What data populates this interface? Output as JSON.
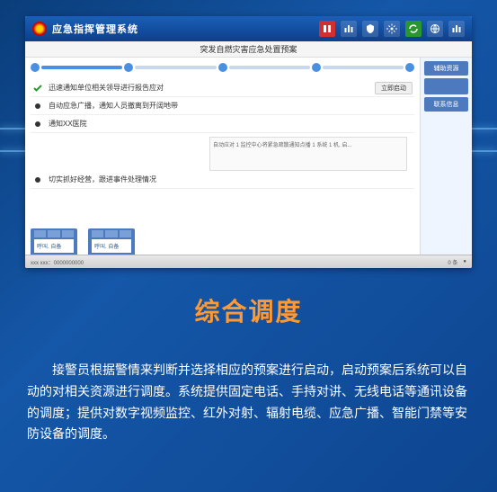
{
  "app": {
    "title": "应急指挥管理系统",
    "subtitle": "突发自燃灾害应急处置预案"
  },
  "header_icons": [
    {
      "name": "alert-icon"
    },
    {
      "name": "stats-icon"
    },
    {
      "name": "shield-icon"
    },
    {
      "name": "gear-icon"
    },
    {
      "name": "refresh-icon"
    },
    {
      "name": "globe-icon"
    },
    {
      "name": "chart-icon"
    }
  ],
  "tasks": [
    {
      "icon": "check",
      "label": "迅速通知单位相关领导进行报告应对",
      "action": "立即启动"
    },
    {
      "icon": "dot",
      "label": "自动应急广播，通知人员撤离到开阔地带",
      "action": ""
    },
    {
      "icon": "dot",
      "label": "通知XX医院",
      "action": ""
    },
    {
      "icon": "dot",
      "label": "切实抓好经营，跟进事件处理情况",
      "action": ""
    }
  ],
  "detail_text": "自动应对 1 监控中心将紧急疏散通知点播 1 系统 1 机, 启...",
  "side_tabs": [
    "辅助资源",
    "",
    "联系信息"
  ],
  "bottom_tabs": [
    {
      "body": "呼叫. 自备"
    },
    {
      "body": "呼叫. 自备"
    }
  ],
  "status": {
    "left": "xxx xxx：0000000000",
    "right": "0 条"
  },
  "page_title": "综合调度",
  "description": "接警员根据警情来判断并选择相应的预案进行启动，启动预案后系统可以自动的对相关资源进行调度。系统提供固定电话、手持对讲、无线电话等通讯设备的调度；提供对数字视频监控、红外对射、辐射电缆、应急广播、智能门禁等安防设备的调度。"
}
